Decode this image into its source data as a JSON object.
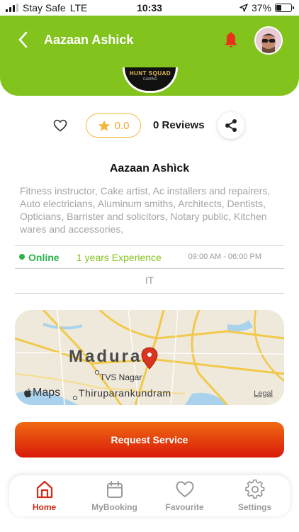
{
  "status_bar": {
    "carrier": "Stay Safe",
    "network": "LTE",
    "time": "10:33",
    "battery": "37%",
    "battery_level": 0.37
  },
  "header": {
    "title": "Aazaan Ashick",
    "back_icon": "chevron-left-icon",
    "bell_icon": "bell-icon",
    "avatar": "user-avatar",
    "bg_color": "#82c31e"
  },
  "provider_logo": {
    "text": "HUNT SQUAD",
    "subtext": "GAMING"
  },
  "actions": {
    "favorite_icon": "heart-icon",
    "rating": "0.0",
    "star_icon": "star-icon",
    "reviews": "0 Reviews",
    "share_icon": "share-icon"
  },
  "profile": {
    "name": "Aazaan Ashìck",
    "services": "Fitness instructor, Cake artist, Ac installers and repairers, Auto electricians, Aluminum smiths, Architects, Dentists, Opticians, Barrister and solicitors, Notary public, Kitchen wares and accessories,",
    "status": "Online",
    "experience": "1 years Experience",
    "hours": "09:00 AM - 06:00 PM",
    "category": "IT"
  },
  "map": {
    "city": "Madurai",
    "area": "TVS Nagar",
    "area2": "Thiruparankundram",
    "brand": "Maps",
    "legal": "Legal"
  },
  "request_button": "Request Service",
  "nav": {
    "items": [
      {
        "label": "Home",
        "icon": "home-icon",
        "active": true
      },
      {
        "label": "MyBooking",
        "icon": "calendar-icon",
        "active": false
      },
      {
        "label": "Favourite",
        "icon": "heart-icon",
        "active": false
      },
      {
        "label": "Settings",
        "icon": "settings-icon",
        "active": false
      }
    ]
  },
  "colors": {
    "accent_green": "#82c31e",
    "online_green": "#2cb24a",
    "star_orange": "#f0a830",
    "primary_red": "#d42a16"
  }
}
